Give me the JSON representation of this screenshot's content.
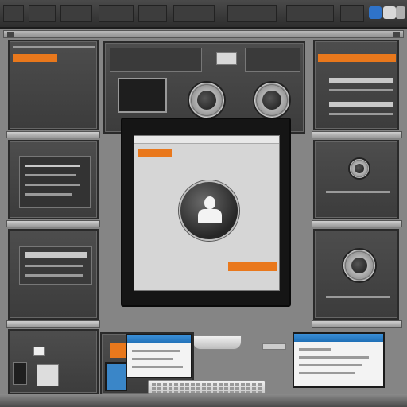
{
  "taskbar": {
    "items": [
      {
        "label": "",
        "name": "taskbar-item-1"
      },
      {
        "label": "",
        "name": "taskbar-item-2"
      },
      {
        "label": "",
        "name": "taskbar-item-3"
      },
      {
        "label": "",
        "name": "taskbar-item-4"
      },
      {
        "label": "",
        "name": "taskbar-item-5"
      },
      {
        "label": "",
        "name": "taskbar-item-6"
      },
      {
        "label": "",
        "name": "taskbar-item-7"
      }
    ]
  },
  "colors": {
    "accent_orange": "#e9781c",
    "window_blue": "#1f6fb6",
    "panel_dark": "#3c3c3c",
    "frame_gray": "#858585"
  },
  "icons": {
    "user": "user-icon",
    "knob": "dial-icon",
    "tray": "system-tray-icon"
  }
}
